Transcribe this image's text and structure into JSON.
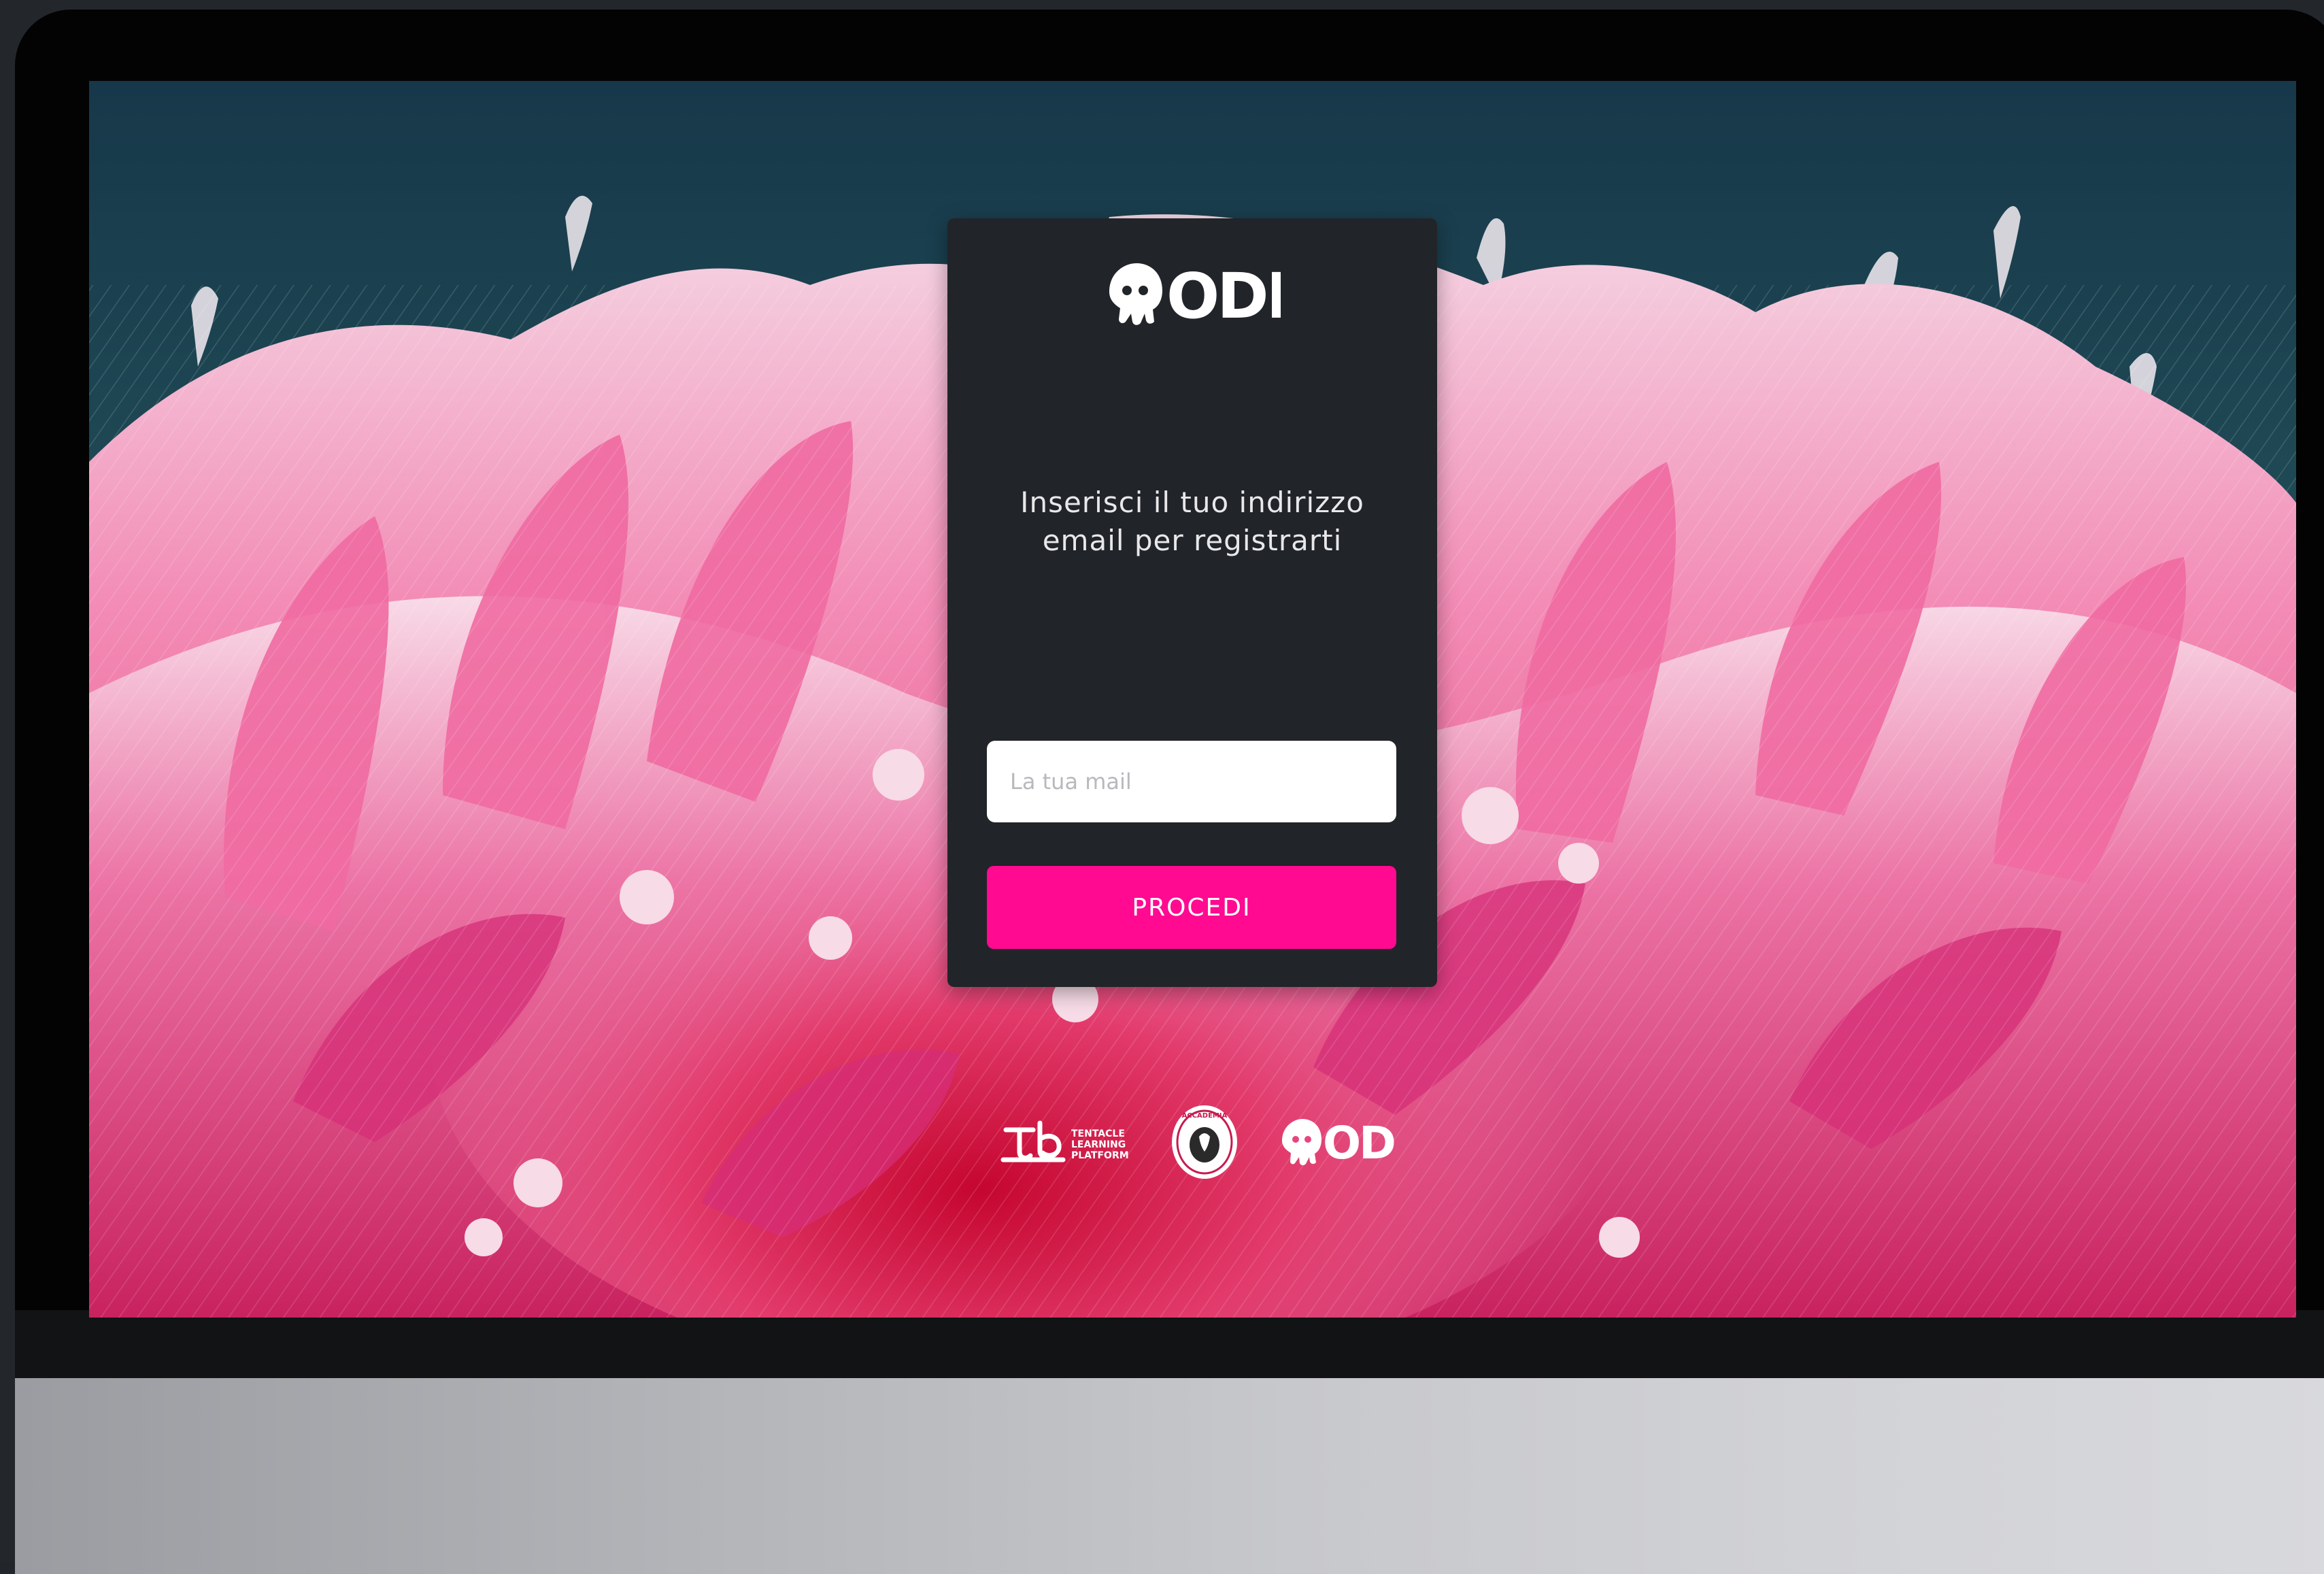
{
  "colors": {
    "card_bg": "#212429",
    "accent": "#ff0a91",
    "bezel": "#030304",
    "chin": "#c7c8cc"
  },
  "card": {
    "logo_text": "ODD",
    "logo_icon": "octopus-icon",
    "prompt_line1": "Inserisci il tuo indirizzo",
    "prompt_line2": "email per registrarti",
    "email_placeholder": "La tua mail",
    "email_value": "",
    "proceed_label": "PROCEDI"
  },
  "footer": {
    "tlp_logo_lines": [
      "TENTACLE",
      "LEARNING",
      "PLATFORM"
    ],
    "seal_logo_text": "ACCADEMIA",
    "odd_logo_text": "ODD"
  },
  "background": {
    "description_icon": "coral-anemone-illustration"
  }
}
